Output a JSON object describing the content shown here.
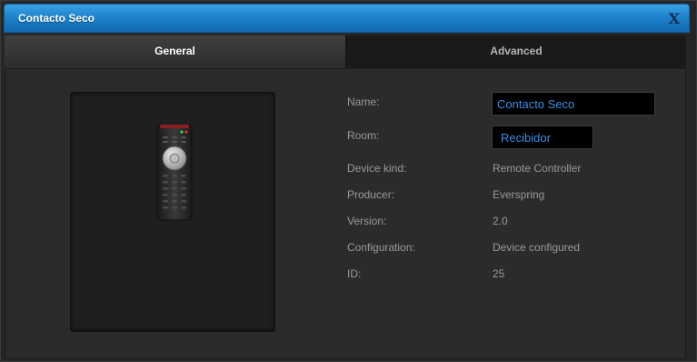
{
  "dialog": {
    "title": "Contacto Seco",
    "close_label": "X"
  },
  "tabs": [
    {
      "label": "General",
      "active": true
    },
    {
      "label": "Advanced",
      "active": false
    }
  ],
  "device": {
    "image_icon": "remote-controller-icon",
    "fields": {
      "name": {
        "label": "Name:",
        "value": "Contacto Seco"
      },
      "room": {
        "label": "Room:",
        "value": "Recibidor"
      }
    },
    "info": [
      {
        "label": "Device kind:",
        "value": "Remote Controller"
      },
      {
        "label": "Producer:",
        "value": "Everspring"
      },
      {
        "label": "Version:",
        "value": "2.0"
      },
      {
        "label": "Configuration:",
        "value": "Device configured"
      },
      {
        "label": "ID:",
        "value": "25"
      }
    ]
  },
  "colors": {
    "titlebar": "#1c7fc9",
    "field_text": "#3b8ee6",
    "label_text": "#9a9a9a"
  }
}
